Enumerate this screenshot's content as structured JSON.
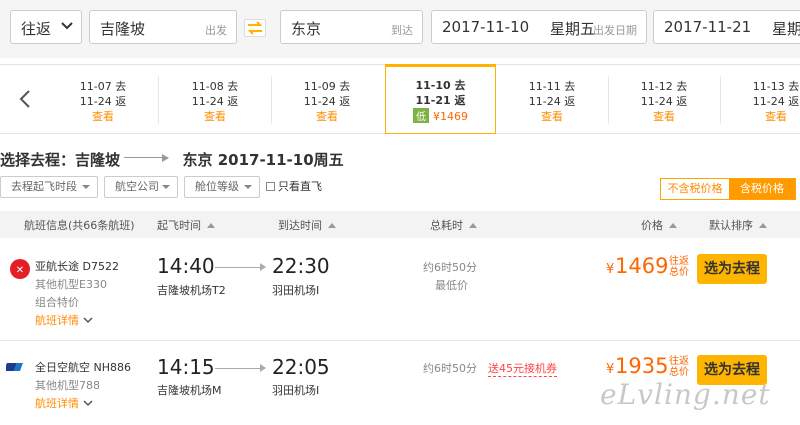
{
  "search": {
    "trip_type": "往返",
    "from_city": "吉隆坡",
    "from_label": "出发",
    "to_city": "东京",
    "to_label": "到达",
    "depart_date": "2017-11-10",
    "depart_weekday": "星期五",
    "depart_label": "出发日期",
    "return_date": "2017-11-21",
    "return_weekday": "星期"
  },
  "dates": [
    {
      "go": "11-07 去",
      "ret": "11-24 返",
      "link": "查看"
    },
    {
      "go": "11-08 去",
      "ret": "11-24 返",
      "link": "查看"
    },
    {
      "go": "11-09 去",
      "ret": "11-24 返",
      "link": "查看"
    },
    {
      "go": "11-10 去",
      "ret": "11-21 返",
      "low_tag": "低",
      "price": "¥1469"
    },
    {
      "go": "11-11 去",
      "ret": "11-24 返",
      "link": "查看"
    },
    {
      "go": "11-12 去",
      "ret": "11-24 返",
      "link": "查看"
    },
    {
      "go": "11-13 去",
      "ret": "11-24 返",
      "link": "查看"
    }
  ],
  "selection": {
    "prefix": "选择去程：吉隆坡",
    "dest": "东京 2017-11-10周五"
  },
  "filters": {
    "time": "去程起飞时段",
    "airline": "航空公司",
    "cabin": "舱位等级",
    "direct": "只看直飞"
  },
  "tax": {
    "excl": "不含税价格",
    "incl": "含税价格"
  },
  "columns": {
    "info": "航班信息(共66条航班)",
    "depart": "起飞时间",
    "arrive": "到达时间",
    "duration": "总耗时",
    "price": "价格",
    "sort": "默认排序"
  },
  "flights": [
    {
      "airline": "亚航长途 D7522",
      "aircraft": "其他机型E330",
      "combo": "组合特价",
      "details": "航班详情",
      "dep_time": "14:40",
      "dep_airport": "吉隆坡机场T2",
      "arr_time": "22:30",
      "arr_airport": "羽田机场I",
      "duration": "约6时50分",
      "note": "最低价",
      "yen": "¥",
      "price": "1469",
      "price_tag1": "往返",
      "price_tag2": "总价",
      "button": "选为去程"
    },
    {
      "airline": "全日空航空 NH886",
      "aircraft": "其他机型788",
      "details": "航班详情",
      "dep_time": "14:15",
      "dep_airport": "吉隆坡机场M",
      "arr_time": "22:05",
      "arr_airport": "羽田机场I",
      "duration": "约6时50分",
      "promo": "送45元接机券",
      "yen": "¥",
      "price": "1935",
      "price_tag1": "往返",
      "price_tag2": "总价",
      "button": "选为去程"
    }
  ],
  "watermark": "eLvling.net",
  "colors": {
    "accent": "#ffb400",
    "price": "#ff6600",
    "low_tag": "#7cb342"
  }
}
